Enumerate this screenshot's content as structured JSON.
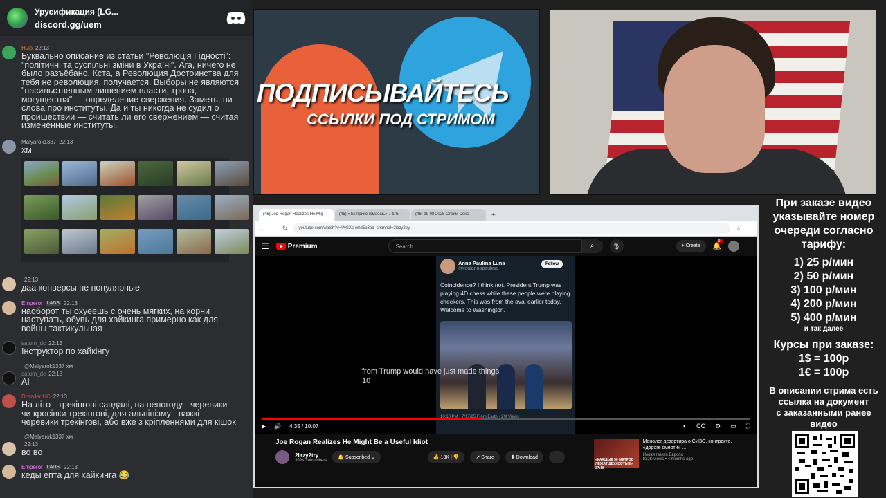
{
  "discord": {
    "server_name": "Урусификация (LG...",
    "invite": "discord.gg/uem",
    "messages": [
      {
        "name": "Нью",
        "time": "22:13",
        "badge": "",
        "reply": "",
        "lines": [
          "Буквально описание из статьи \"Революція Гідності\":",
          "\"політичні та суспільні зміни в Україні\". Ага, ничего не",
          "было разъёбано. Кста, а Революция Достоинства для",
          "тебя не революция, получается. Выборы не являются",
          "\"насильственным лишением власти, трона,",
          "могущества\" — определение свержения. Заметь, ни",
          "слова про институты. Да и ты никогда не судил о",
          "проишествии — считать ли его свержением — считая",
          "изменённые институты."
        ]
      },
      {
        "name": "Malyarok1337",
        "time": "22:13",
        "badge": "",
        "reply": "",
        "lines": [
          "хм"
        ]
      },
      {
        "name": "",
        "time": "22:13",
        "badge": "",
        "reply": "",
        "lines": [
          "даа конверсы не популярные"
        ]
      },
      {
        "name": "Emperor",
        "time": "22:13",
        "badge": "LADS",
        "reply": "",
        "lines": [
          "наоборот ты охуеешь с очень мягких, на корни",
          "наступать, обувь для хайкинга примерно как для",
          "войны тактикульная"
        ]
      },
      {
        "name": "saturn_dc",
        "time": "22:13",
        "badge": "",
        "reply": "",
        "lines": [
          "Інструктор по хайкінгу"
        ]
      },
      {
        "name": "saturn_dc",
        "time": "22:13",
        "badge": "",
        "reply": "@Malyarok1337 хм",
        "lines": [
          "AI"
        ]
      },
      {
        "name": "DrezdenHC",
        "time": "22:13",
        "badge": "",
        "reply": "",
        "lines": [
          "На літо - трекінгові сандалі, на непогоду - черевики",
          "чи кросівки трекінгові, для альпінізму - важкі",
          "черевики трекінгові, або вже з кріпленнями для кішок"
        ]
      },
      {
        "name": "",
        "time": "22:13",
        "badge": "",
        "reply": "@Malyarok1337 хм",
        "lines": [
          "во во"
        ]
      },
      {
        "name": "Emperor",
        "time": "22:13",
        "badge": "LADS",
        "reply": "",
        "lines": [
          "кеды епта для хайкинга 😂"
        ]
      }
    ]
  },
  "promo": {
    "title": "ПОДПИСЫВАЙТЕСЬ",
    "subtitle": "ССЫЛКИ ПОД СТРИМОМ"
  },
  "browser": {
    "tabs": [
      "(45) Joe Rogan Realizes He Mig",
      "(45) «Ты прикономаешь»... в ти",
      "(46) 19 08 2025 Стрим Секс"
    ],
    "url": "youtube.com/watch?v=VySXc-whd5o8ab_channel=2lazy2try",
    "search_placeholder": "Search",
    "create_label": "Create",
    "notif_count": "9+",
    "logo_label": "Premium"
  },
  "tweet": {
    "name": "Anna Paulina Luna",
    "handle": "@realannapaulina",
    "follow": "Follow",
    "text": "Coincidence? I think not. President Trump was playing 4D chess while these people were playing checkers. This was from the oval earlier today. Welcome to Washington.",
    "meta": "10:10 PM · 7/17/25 From Earth · 2M Views"
  },
  "player": {
    "caption_1": "from Trump would have just made things",
    "caption_2": "10",
    "time": "4:35 / 10:07",
    "progress": 0.45
  },
  "video": {
    "title": "Joe Rogan Realizes He Might Be a Useful Idiot",
    "channel": "2lazy2try",
    "subscribers": "399K subscribers",
    "subscribed": "Subscribed",
    "likes": "13K",
    "share": "Share",
    "download": "Download"
  },
  "recommended": {
    "title": "Монолог дезертира о СИЗО, контракте, «дороге смерти» ...",
    "channel": "Новая газета Европа",
    "meta": "832K views • 4 months ago",
    "thumb_text": "«КАЖДЫЕ 50 МЕТРОВ ЛЕЖАТ ДВУХСОТЫЕ»",
    "duration": "27:18"
  },
  "info": {
    "order_text": [
      "При заказе видео",
      "указывайте номер",
      "очереди согласно",
      "тарифу:"
    ],
    "tariffs": [
      "1) 25 р/мин",
      "2) 50 р/мин",
      "3) 100 р/мин",
      "4) 200 р/мин",
      "5) 400 р/мин"
    ],
    "etc": "и так далее",
    "courses_title": "Курсы при заказе:",
    "courses": [
      "1$ = 100р",
      "1€ = 100р"
    ],
    "description": [
      "В описании стрима есть",
      "ссылка на документ",
      "с заказанными ранее",
      "видео"
    ]
  }
}
